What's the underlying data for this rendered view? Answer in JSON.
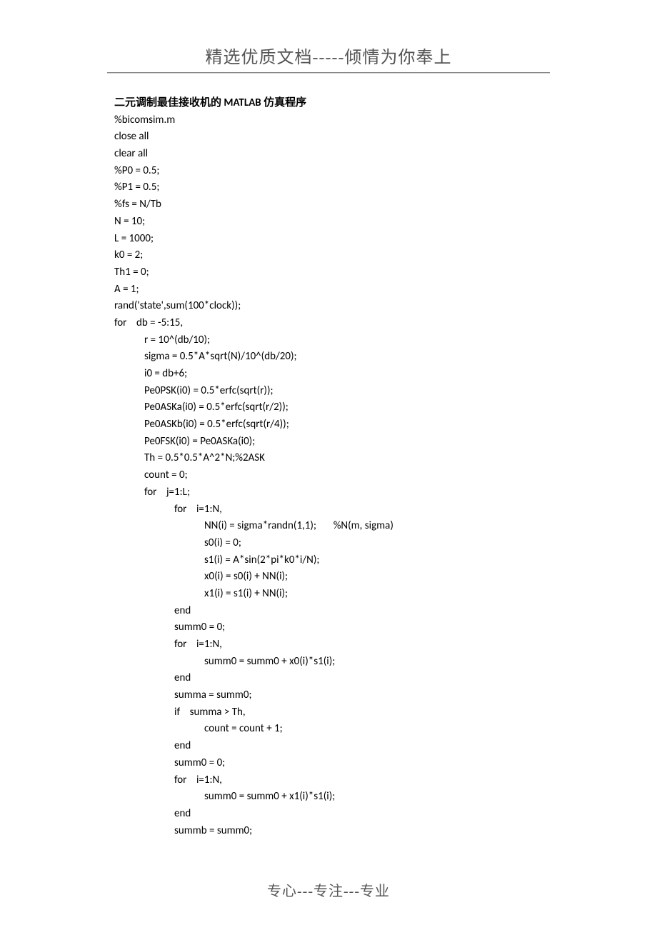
{
  "header": "精选优质文档-----倾情为你奉上",
  "footer": "专心---专注---专业",
  "title": "二元调制最佳接收机的 MATLAB 仿真程序",
  "code": [
    {
      "indent": 0,
      "text": "%bicomsim.m"
    },
    {
      "indent": 0,
      "text": "close all"
    },
    {
      "indent": 0,
      "text": "clear all"
    },
    {
      "indent": 0,
      "text": "%P0 = 0.5;"
    },
    {
      "indent": 0,
      "text": "%P1 = 0.5;"
    },
    {
      "indent": 0,
      "text": "%fs = N/Tb"
    },
    {
      "indent": 0,
      "text": "N = 10;"
    },
    {
      "indent": 0,
      "text": "L = 1000;"
    },
    {
      "indent": 0,
      "text": "k0 = 2;"
    },
    {
      "indent": 0,
      "text": "Th1 = 0;"
    },
    {
      "indent": 0,
      "text": "A = 1;"
    },
    {
      "indent": 0,
      "text": "rand('state',sum(100*clock));"
    },
    {
      "indent": 0,
      "text": "for    db = -5:15,"
    },
    {
      "indent": 1,
      "text": "r = 10^(db/10);"
    },
    {
      "indent": 1,
      "text": "sigma = 0.5*A*sqrt(N)/10^(db/20);"
    },
    {
      "indent": 1,
      "text": "i0 = db+6;"
    },
    {
      "indent": 1,
      "text": "Pe0PSK(i0) = 0.5*erfc(sqrt(r));"
    },
    {
      "indent": 1,
      "text": "Pe0ASKa(i0) = 0.5*erfc(sqrt(r/2));"
    },
    {
      "indent": 1,
      "text": "Pe0ASKb(i0) = 0.5*erfc(sqrt(r/4));"
    },
    {
      "indent": 1,
      "text": "Pe0FSK(i0) = Pe0ASKa(i0);"
    },
    {
      "indent": 1,
      "text": "Th = 0.5*0.5*A^2*N;%2ASK"
    },
    {
      "indent": 1,
      "text": "count = 0;"
    },
    {
      "indent": 1,
      "text": "for    j=1:L;"
    },
    {
      "indent": 2,
      "text": "for    i=1:N,"
    },
    {
      "indent": 3,
      "text": "NN(i) = sigma*randn(1,1);       %N(m, sigma)"
    },
    {
      "indent": 3,
      "text": "s0(i) = 0;"
    },
    {
      "indent": 3,
      "text": "s1(i) = A*sin(2*pi*k0*i/N);"
    },
    {
      "indent": 3,
      "text": "x0(i) = s0(i) + NN(i);"
    },
    {
      "indent": 3,
      "text": "x1(i) = s1(i) + NN(i);"
    },
    {
      "indent": 2,
      "text": "end"
    },
    {
      "indent": 2,
      "text": "summ0 = 0;"
    },
    {
      "indent": 2,
      "text": "for    i=1:N,"
    },
    {
      "indent": 3,
      "text": "summ0 = summ0 + x0(i)*s1(i);"
    },
    {
      "indent": 2,
      "text": "end"
    },
    {
      "indent": 2,
      "text": "summa = summ0;"
    },
    {
      "indent": 2,
      "text": "if    summa > Th,"
    },
    {
      "indent": 3,
      "text": "count = count + 1;"
    },
    {
      "indent": 2,
      "text": "end"
    },
    {
      "indent": 2,
      "text": "summ0 = 0;"
    },
    {
      "indent": 2,
      "text": "for    i=1:N,"
    },
    {
      "indent": 3,
      "text": "summ0 = summ0 + x1(i)*s1(i);"
    },
    {
      "indent": 2,
      "text": "end"
    },
    {
      "indent": 2,
      "text": "summb = summ0;"
    }
  ]
}
